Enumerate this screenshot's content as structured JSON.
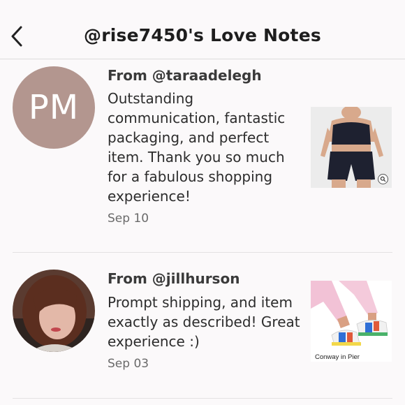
{
  "header": {
    "title": "@rise7450's Love Notes",
    "back_icon": "chevron-left-icon"
  },
  "notes": [
    {
      "from": "From @taraadelegh",
      "avatar_initials": "PM",
      "avatar_color": "#b3968f",
      "message": "Outstanding communication, fantastic packaging, and perfect item. Thank you so much for a fabulous shopping experience!",
      "date": "Sep 10",
      "thumb_icon": "zoom-icon"
    },
    {
      "from": "From @jillhurson",
      "message": "Prompt shipping, and item exactly as described! Great experience :)",
      "date": "Sep 03",
      "thumb_caption": "Conway in Pier"
    }
  ]
}
